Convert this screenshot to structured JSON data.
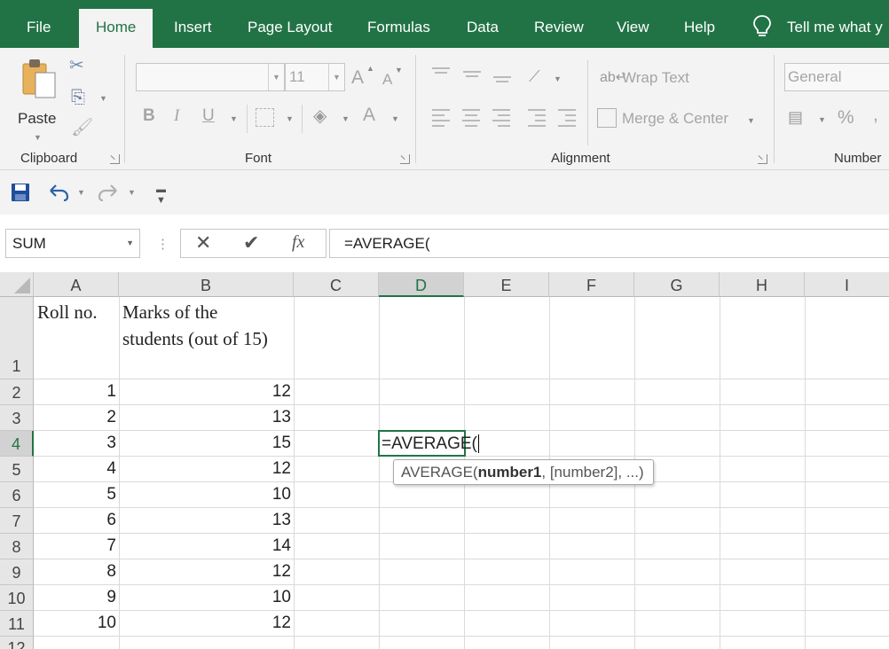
{
  "tabs": [
    {
      "label": "File"
    },
    {
      "label": "Home"
    },
    {
      "label": "Insert"
    },
    {
      "label": "Page Layout"
    },
    {
      "label": "Formulas"
    },
    {
      "label": "Data"
    },
    {
      "label": "Review"
    },
    {
      "label": "View"
    },
    {
      "label": "Help"
    }
  ],
  "tell_me": "Tell me what y",
  "ribbon": {
    "clipboard": {
      "paste_label": "Paste",
      "group_label": "Clipboard"
    },
    "font": {
      "name_value": "",
      "size_value": "11",
      "group_label": "Font",
      "bold": "B",
      "italic": "I",
      "underline": "U",
      "grow": "A",
      "shrink": "A",
      "font_color": "A"
    },
    "alignment": {
      "wrap_text": "Wrap Text",
      "merge_center": "Merge & Center",
      "group_label": "Alignment"
    },
    "number": {
      "format_value": "General",
      "percent": "%",
      "group_label": "Number"
    }
  },
  "formula_bar": {
    "name_box": "SUM",
    "fx": "fx",
    "formula": "=AVERAGE("
  },
  "columns": [
    "A",
    "B",
    "C",
    "D",
    "E",
    "F",
    "G",
    "H",
    "I"
  ],
  "rows": [
    "1",
    "2",
    "3",
    "4",
    "5",
    "6",
    "7",
    "8",
    "9",
    "10",
    "11",
    "12"
  ],
  "sheet": {
    "header_a": "Roll no.",
    "header_b_line1": "Marks of the",
    "header_b_line2": "students (out of 15)",
    "roll_numbers": [
      "1",
      "2",
      "3",
      "4",
      "5",
      "6",
      "7",
      "8",
      "9",
      "10"
    ],
    "marks": [
      "12",
      "13",
      "15",
      "12",
      "10",
      "13",
      "14",
      "12",
      "10",
      "12"
    ],
    "editing_cell_text": "=AVERAGE(",
    "tooltip_func": "AVERAGE(",
    "tooltip_arg1": "number1",
    "tooltip_rest": ", [number2], ...)"
  },
  "colors": {
    "accent": "#217346",
    "ribbon_bg": "#f3f3f3",
    "header_bg": "#e6e6e6"
  }
}
